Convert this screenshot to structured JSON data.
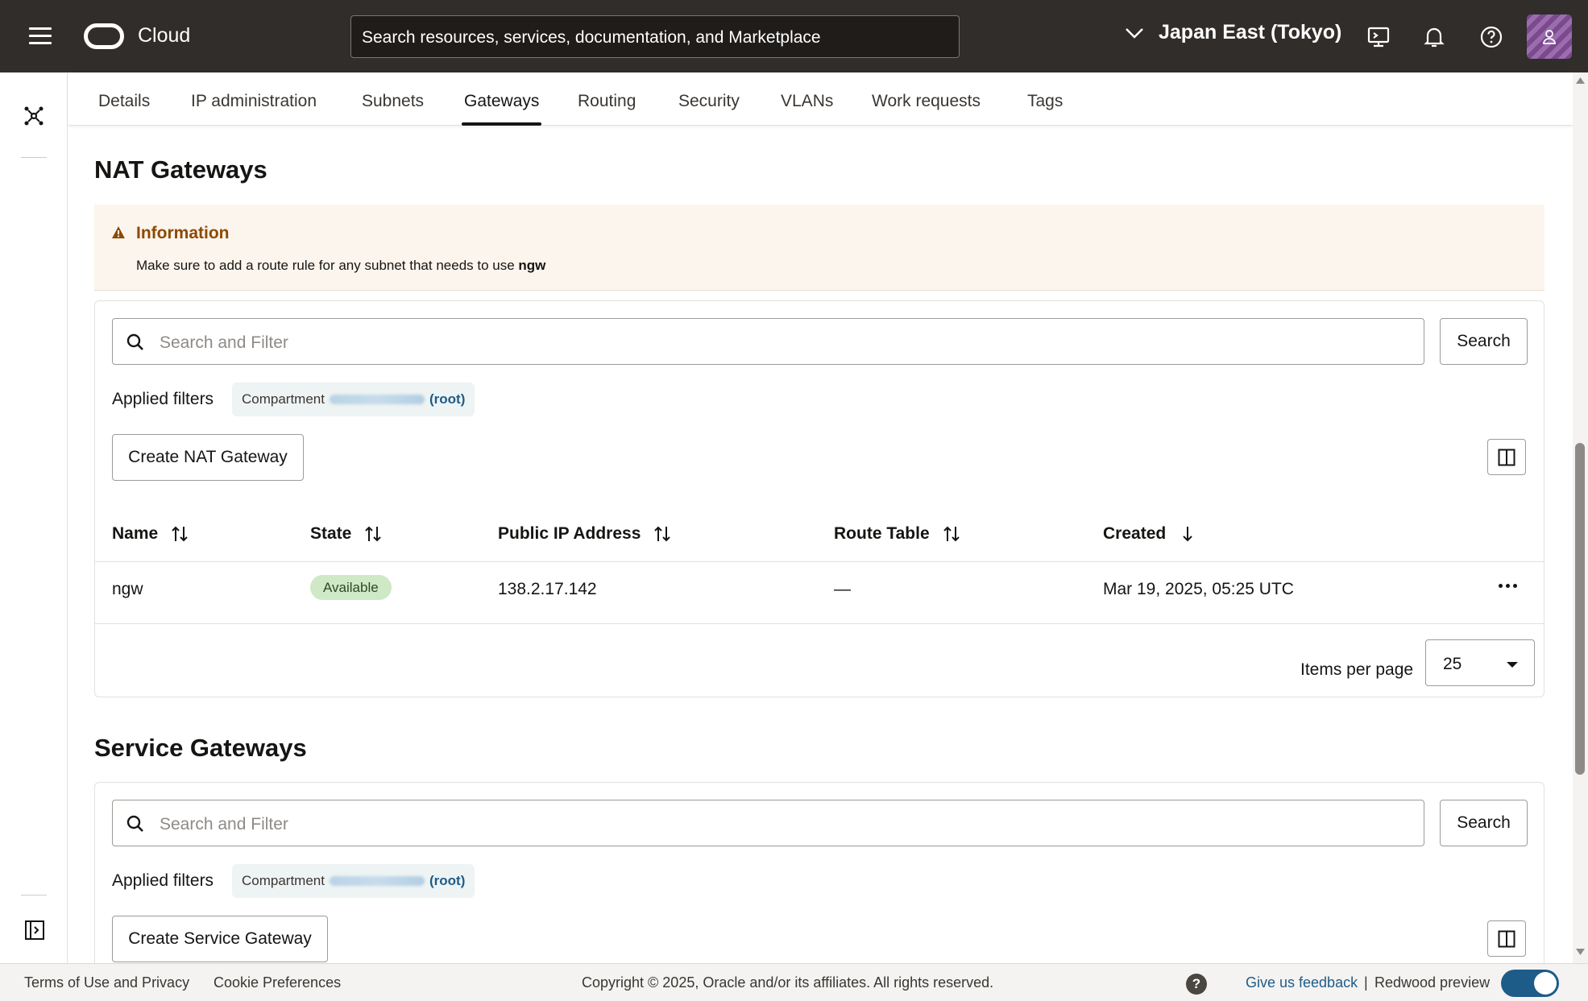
{
  "header": {
    "brand": "Cloud",
    "search_placeholder": "Search resources, services, documentation, and Marketplace",
    "region": "Japan East (Tokyo)"
  },
  "tabs": [
    {
      "label": "Details"
    },
    {
      "label": "IP administration"
    },
    {
      "label": "Subnets"
    },
    {
      "label": "Gateways",
      "active": true
    },
    {
      "label": "Routing"
    },
    {
      "label": "Security"
    },
    {
      "label": "VLANs"
    },
    {
      "label": "Work requests"
    },
    {
      "label": "Tags"
    }
  ],
  "nat": {
    "title": "NAT Gateways",
    "info_title": "Information",
    "info_body": "Make sure to add a route rule for any subnet that needs to use ",
    "info_body_bold": "ngw",
    "search_placeholder": "Search and Filter",
    "search_button": "Search",
    "applied_filters": "Applied filters",
    "chip_label": "Compartment",
    "chip_root": "(root)",
    "create_button": "Create NAT Gateway",
    "columns": [
      "Name",
      "State",
      "Public IP Address",
      "Route Table",
      "Created"
    ],
    "rows": [
      {
        "name": "ngw",
        "state": "Available",
        "public_ip": "138.2.17.142",
        "route_table": "—",
        "created": "Mar 19, 2025, 05:25 UTC"
      }
    ],
    "items_per_page_label": "Items per page",
    "items_per_page_value": "25"
  },
  "service": {
    "title": "Service Gateways",
    "search_placeholder": "Search and Filter",
    "search_button": "Search",
    "applied_filters": "Applied filters",
    "chip_label": "Compartment",
    "chip_root": "(root)",
    "create_button": "Create Service Gateway"
  },
  "footer": {
    "terms": "Terms of Use and Privacy",
    "cookies": "Cookie Preferences",
    "copyright": "Copyright © 2025, Oracle and/or its affiliates. All rights reserved.",
    "help": "?",
    "feedback": "Give us feedback",
    "separator": "|",
    "redwood": "Redwood preview"
  },
  "colors": {
    "header_bg": "#312d2a",
    "info_bg": "#fcf5ee",
    "info_title": "#8c4a00",
    "badge_bg": "#cfe8c6",
    "link": "#1d5c89"
  }
}
